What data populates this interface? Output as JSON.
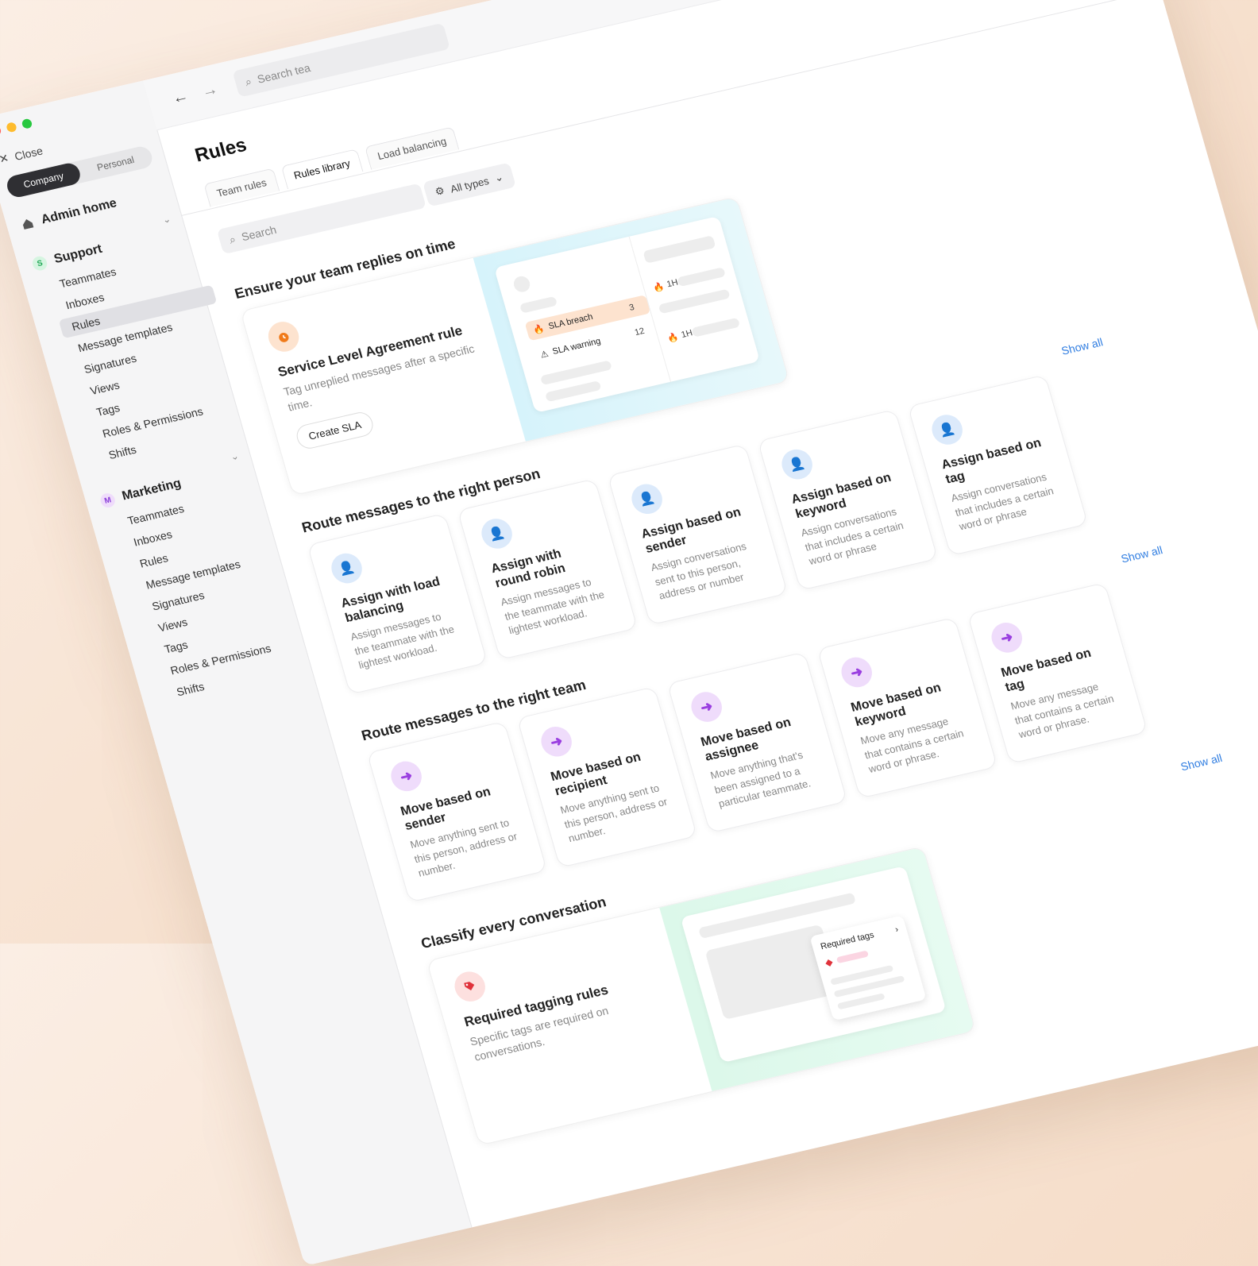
{
  "sidebar": {
    "close_label": "Close",
    "segments": [
      "Company",
      "Personal"
    ],
    "admin_home": "Admin home",
    "groups": [
      {
        "badge": "S",
        "name": "Support",
        "badge_color": "#1fa855",
        "items": [
          "Teammates",
          "Inboxes",
          "Rules",
          "Message templates",
          "Signatures",
          "Views",
          "Tags",
          "Roles & Permissions",
          "Shifts"
        ]
      },
      {
        "badge": "M",
        "name": "Marketing",
        "badge_color": "#8a3fd8",
        "items": [
          "Teammates",
          "Inboxes",
          "Rules",
          "Message templates",
          "Signatures",
          "Views",
          "Tags",
          "Roles & Permissions",
          "Shifts"
        ]
      }
    ]
  },
  "topbar": {
    "search_placeholder": "Search tea"
  },
  "main": {
    "title": "Rules",
    "tabs": [
      "Team rules",
      "Rules library",
      "Load balancing"
    ],
    "search_placeholder": "Search",
    "type_filter": "All types"
  },
  "sections": {
    "sla": {
      "title": "Ensure your team replies on time",
      "card_title": "Service Level Agreement rule",
      "card_desc": "Tag unreplied messages after a specific time.",
      "button": "Create SLA",
      "mock": {
        "breach": "SLA breach",
        "breach_count": "3",
        "warning": "SLA warning",
        "warning_count": "12",
        "t1": "1H",
        "t2": "1H"
      }
    },
    "person": {
      "title": "Route messages to the right person",
      "show_all": "Show all",
      "cards": [
        {
          "title": "Assign with load balancing",
          "desc": "Assign messages to the teammate with the lightest workload."
        },
        {
          "title": "Assign with round robin",
          "desc": "Assign messages to the teammate with the lightest workload."
        },
        {
          "title": "Assign based on sender",
          "desc": "Assign conversations sent to this person, address or number"
        },
        {
          "title": "Assign based on keyword",
          "desc": "Assign conversations that includes a certain word or phrase"
        },
        {
          "title": "Assign based on tag",
          "desc": "Assign conversations that includes a certain word or phrase"
        }
      ]
    },
    "team": {
      "title": "Route messages to the right team",
      "show_all": "Show all",
      "cards": [
        {
          "title": "Move based on sender",
          "desc": "Move anything sent to this person, address or number."
        },
        {
          "title": "Move based on recipient",
          "desc": "Move anything sent to this person, address or number."
        },
        {
          "title": "Move based on assignee",
          "desc": "Move anything that's been assigned to a particular teammate."
        },
        {
          "title": "Move based on keyword",
          "desc": "Move any message that contains a certain word or phrase."
        },
        {
          "title": "Move based on tag",
          "desc": "Move any message that contains a certain word or phrase."
        }
      ]
    },
    "classify": {
      "title": "Classify every conversation",
      "show_all": "Show all",
      "card_title": "Required tagging rules",
      "card_desc": "Specific tags are required on conversations.",
      "mock_label": "Required tags"
    }
  },
  "colors": {
    "sla_icon_bg": "#fde3cf",
    "sla_icon": "#f07a1a",
    "assign_icon_bg": "#dceafb",
    "assign_icon": "#2f7de1",
    "move_icon_bg": "#efdcfb",
    "move_icon": "#9a3fe0",
    "tag_icon_bg": "#fde0df",
    "tag_icon": "#e0323b"
  }
}
